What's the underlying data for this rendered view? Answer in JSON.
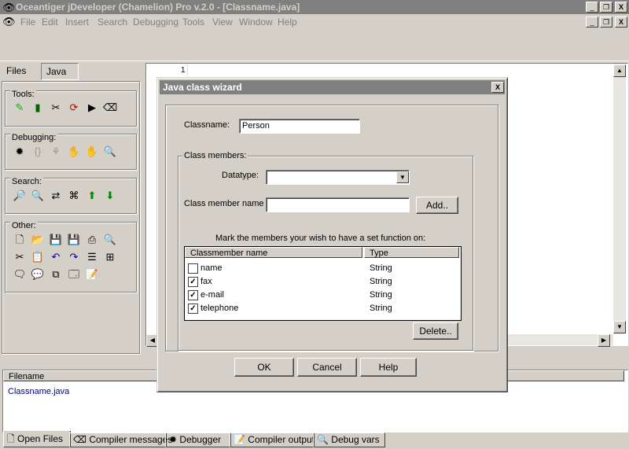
{
  "window": {
    "title": "Oceantiger jDeveloper (Chamelion) Pro  v.2.0 - [Classname.java]",
    "controls": [
      "_",
      "❐",
      "X"
    ]
  },
  "menu": [
    "File",
    "Edit",
    "Insert",
    "Search",
    "Debugging",
    "Tools",
    "View",
    "Window",
    "Help"
  ],
  "left_panel": {
    "tabs": [
      "Files",
      "Java"
    ],
    "active_tab": "Java",
    "groups": {
      "tools": "Tools:",
      "debugging": "Debugging:",
      "search": "Search:",
      "other": "Other:"
    }
  },
  "editor": {
    "line_number": "1"
  },
  "dialog": {
    "title": "Java class wizard",
    "close": "X",
    "classname_label": "Classname:",
    "classname_value": "Person",
    "class_members_label": "Class members:",
    "datatype_label": "Datatype:",
    "datatype_value": "",
    "member_name_label": "Class member name",
    "member_name_value": "",
    "add_button": "Add..",
    "set_function_label": "Mark the members your wish to have a set function on:",
    "table": {
      "columns": [
        "Classmember name",
        "Type"
      ],
      "rows": [
        {
          "name": "name",
          "type": "String",
          "checked": false
        },
        {
          "name": "fax",
          "type": "String",
          "checked": true
        },
        {
          "name": "e-mail",
          "type": "String",
          "checked": true
        },
        {
          "name": "telephone",
          "type": "String",
          "checked": true
        }
      ]
    },
    "delete_button": "Delete..",
    "ok_button": "OK",
    "cancel_button": "Cancel",
    "help_button": "Help"
  },
  "bottom_panel": {
    "header": "Filename",
    "files": [
      "Classname.java"
    ],
    "tabs": [
      "Open Files",
      "Compiler messages",
      "Debugger",
      "Compiler output",
      "Debug vars"
    ],
    "active_tab": "Open Files"
  },
  "colors": {
    "face": "#d4d0c8",
    "inactive_title": "#808080",
    "link_blue": "#000080"
  }
}
